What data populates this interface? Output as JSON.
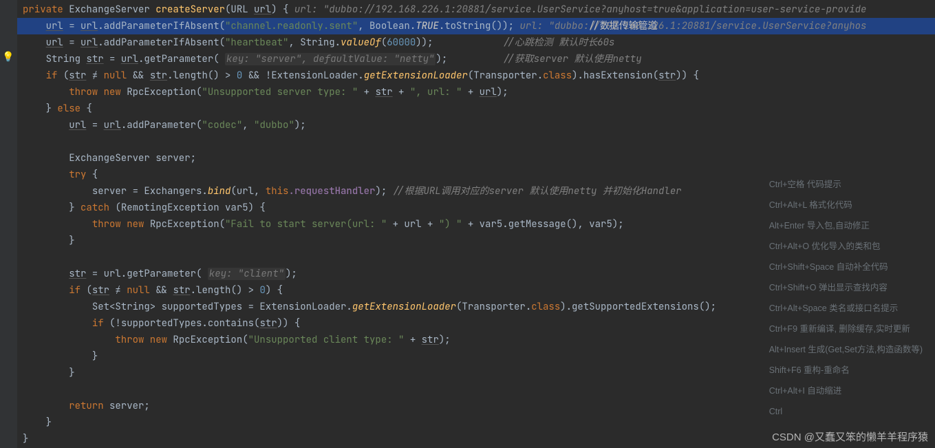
{
  "code": {
    "l1_kw_private": "private",
    "l1_ret": " ExchangeServer ",
    "l1_fn": "createServer",
    "l1_paren_open": "(URL ",
    "l1_param_url": "url",
    "l1_rest": ") {   ",
    "l1_hint": "url: \"dubbo://192.168.226.1:20881/service.UserService?anyhost=true&application=user-service-provide",
    "l2_pre": "url",
    "l2_eq": " = ",
    "l2_url2": "url",
    "l2_call": ".addParameterIfAbsent(",
    "l2_str": "\"channel.readonly.sent\"",
    "l2_after_str": ", Boolean.",
    "l2_true": "TRUE",
    "l2_tostr": ".toString());   ",
    "l2_hint": "url: \"dubbo://192.168.226.1:20881/service.UserService?anyhos",
    "l2_comment": "//数据传输管道",
    "l3_pre": "url",
    "l3_eq2": " = ",
    "l3_url2": "url",
    "l3_call2": ".addParameterIfAbsent(",
    "l3_str": "\"heartbeat\"",
    "l3_mid": ", String.",
    "l3_valueOf": "valueOf",
    "l3_open": "(",
    "l3_num": "60000",
    "l3_close": "));",
    "l3_comment": "//心跳检测 默认时长60s",
    "l4_pre": "String ",
    "l4_strvar": "str",
    "l4_eq": " = ",
    "l4_url": "url",
    "l4_call": ".getParameter( ",
    "l4_hint": "key: \"server\",   defaultValue: \"netty\"",
    "l4_end": ");",
    "l4_comment": "//获取server 默认使用netty",
    "l5_if": "if",
    "l5_open": " (",
    "l5_strvar": "str",
    "l5_neq": " ≠ ",
    "l5_null": "null",
    "l5_and1": " && ",
    "l5_str2": "str",
    "l5_len": ".length() > ",
    "l5_zero": "0",
    "l5_and2": " && !ExtensionLoader.",
    "l5_gel": "getExtensionLoader",
    "l5_after_gel": "(Transporter.",
    "l5_class": "class",
    "l5_hasExt": ").hasExtension(",
    "l5_str3": "str",
    "l5_end": ")) {",
    "l6_throw": "throw new",
    "l6_exc": " RpcException(",
    "l6_msg": "\"Unsupported server type: \"",
    "l6_plus1": " + ",
    "l6_strv": "str",
    "l6_plus2": " + ",
    "l6_msg2": "\", url: \"",
    "l6_plus3": " + ",
    "l6_urlv": "url",
    "l6_end": ");",
    "l7_close_else": "} ",
    "l7_else": "else",
    "l7_open": " {",
    "l8_url1": "url",
    "l8_eq": " = ",
    "l8_url2": "url",
    "l8_call": ".addParameter(",
    "l8_codec": "\"codec\"",
    "l8_comma": ", ",
    "l8_dubbo": "\"dubbo\"",
    "l8_end": ");",
    "l10_decl": "ExchangeServer server;",
    "l11_try": "try",
    "l11_open": " {",
    "l12_assign": "server = Exchangers.",
    "l12_bind": "bind",
    "l12_args_open": "(url, ",
    "l12_this": "this",
    "l12_rh": ".requestHandler",
    "l12_close": ");   ",
    "l12_comment": "//根据URL调用对应的server 默认使用netty 并初始化Handler",
    "l13_close": "} ",
    "l13_catch": "catch",
    "l13_args": " (RemotingException var5) {",
    "l14_throw": "throw new",
    "l14_exc": " RpcException(",
    "l14_msg": "\"Fail to start server(url: \"",
    "l14_mid": " + url + ",
    "l14_msg2": "\") \"",
    "l14_mid2": " + var5.getMessage(), var5);",
    "l15_close": "}",
    "l17_str": "str",
    "l17_eq": " = url.getParameter( ",
    "l17_hint": "key: \"client\"",
    "l17_end": ");",
    "l18_if": "if",
    "l18_open": " (",
    "l18_str1": "str",
    "l18_neq": " ≠ ",
    "l18_null": "null",
    "l18_and": " && ",
    "l18_str2": "str",
    "l18_len": ".length() > ",
    "l18_zero": "0",
    "l18_end": ") {",
    "l19_pre": "Set<String> supportedTypes = ExtensionLoader.",
    "l19_gel": "getExtensionLoader",
    "l19_mid": "(Transporter.",
    "l19_class": "class",
    "l19_end": ").getSupportedExtensions();",
    "l20_if": "if",
    "l20_cond": " (!supportedTypes.contains(",
    "l20_str": "str",
    "l20_end": ")) {",
    "l21_throw": "throw new",
    "l21_exc": " RpcException(",
    "l21_msg": "\"Unsupported client type: \"",
    "l21_plus": " + ",
    "l21_str": "str",
    "l21_end": ");",
    "l22_close": "}",
    "l23_close": "}",
    "l25_ret": "return",
    "l25_srv": " server;",
    "l26_close": "}",
    "l27_close": "}"
  },
  "shortcuts": [
    "Ctrl+空格  代码提示",
    "Ctrl+Alt+L  格式化代码",
    "Alt+Enter 导入包,自动修正",
    "Ctrl+Alt+O  优化导入的类和包",
    "Ctrl+Shift+Space 自动补全代码",
    "Ctrl+Shift+O  弹出显示查找内容",
    "Ctrl+Alt+Space  类名或接口名提示",
    "Ctrl+F9 重新编译, 删除缓存,实时更新",
    "Alt+Insert  生成(Get,Set方法,构造函数等)",
    "",
    "Shift+F6  重构-重命名",
    "Ctrl+Alt+I 自动缩进",
    "Ctrl"
  ],
  "watermark": "CSDN @又蠢又笨的懒羊羊程序猿"
}
